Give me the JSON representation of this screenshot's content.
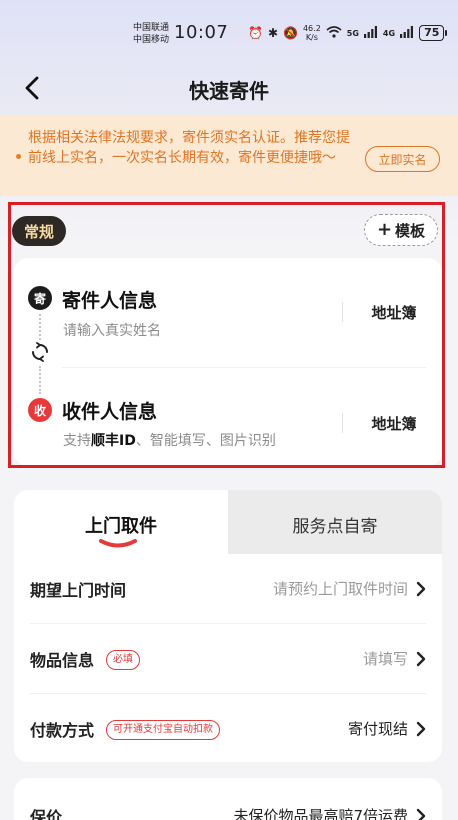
{
  "status_bar": {
    "carrier_1": "中国联通",
    "carrier_2": "中国移动",
    "time": "10:07",
    "speed_value": "46.2",
    "speed_unit": "K/s",
    "network_1": "5G",
    "network_2": "4G",
    "battery": "75"
  },
  "nav": {
    "title": "快速寄件"
  },
  "notice": {
    "text": "根据相关法律法规要求，寄件须实名认证。推荐您提前线上实名，一次实名长期有效，寄件更便捷哦～",
    "button_label": "立即实名",
    "accent_color": "#e07523"
  },
  "mode": {
    "badge_label": "常规",
    "template_label": "模板"
  },
  "sender": {
    "icon_char": "寄",
    "title": "寄件人信息",
    "placeholder": "请输入真实姓名",
    "address_book_label": "地址簿"
  },
  "receiver": {
    "icon_char": "收",
    "title": "收件人信息",
    "hint_prefix": "支持",
    "hint_bold": "顺丰ID",
    "hint_suffix": "、智能填写、图片识别",
    "address_book_label": "地址簿"
  },
  "service": {
    "tabs": [
      {
        "label": "上门取件",
        "active": true
      },
      {
        "label": "服务点自寄",
        "active": false
      }
    ],
    "rows": [
      {
        "label": "期望上门时间",
        "value": "请预约上门取件时间",
        "tag": ""
      },
      {
        "label": "物品信息",
        "value": "请填写",
        "tag": "必填"
      },
      {
        "label": "付款方式",
        "value": "寄付现结",
        "tag": "可开通支付宝自动扣款"
      }
    ]
  },
  "insurance": {
    "label": "保价",
    "value": "未保价物品最高赔7倍运费"
  },
  "colors": {
    "brand_red": "#e5393a",
    "highlight_red": "#d81f23"
  }
}
